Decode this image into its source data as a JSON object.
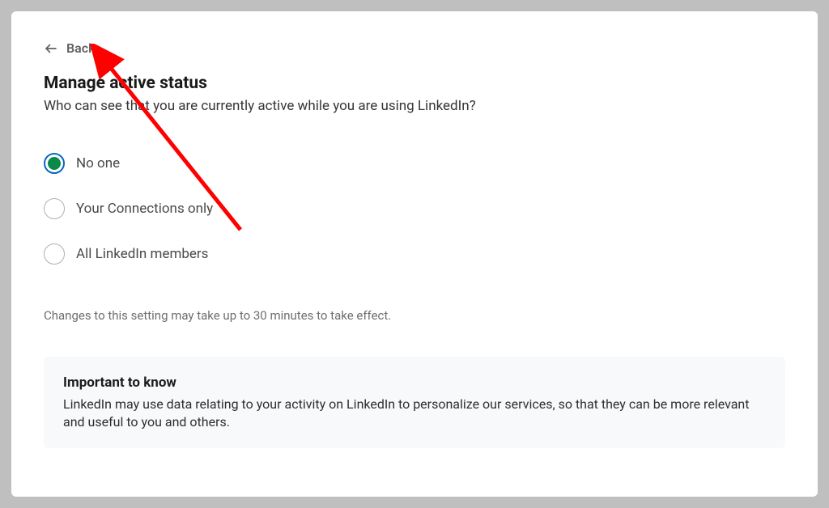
{
  "back": {
    "label": "Back"
  },
  "header": {
    "title": "Manage active status",
    "subtitle": "Who can see that you are currently active while you are using LinkedIn?"
  },
  "options": [
    {
      "label": "No one",
      "selected": true
    },
    {
      "label": "Your Connections only",
      "selected": false
    },
    {
      "label": "All LinkedIn members",
      "selected": false
    }
  ],
  "note": "Changes to this setting may take up to 30 minutes to take effect.",
  "info": {
    "title": "Important to know",
    "body": "LinkedIn may use data relating to your activity on LinkedIn to personalize our services, so that they can be more relevant and useful to you and others."
  }
}
